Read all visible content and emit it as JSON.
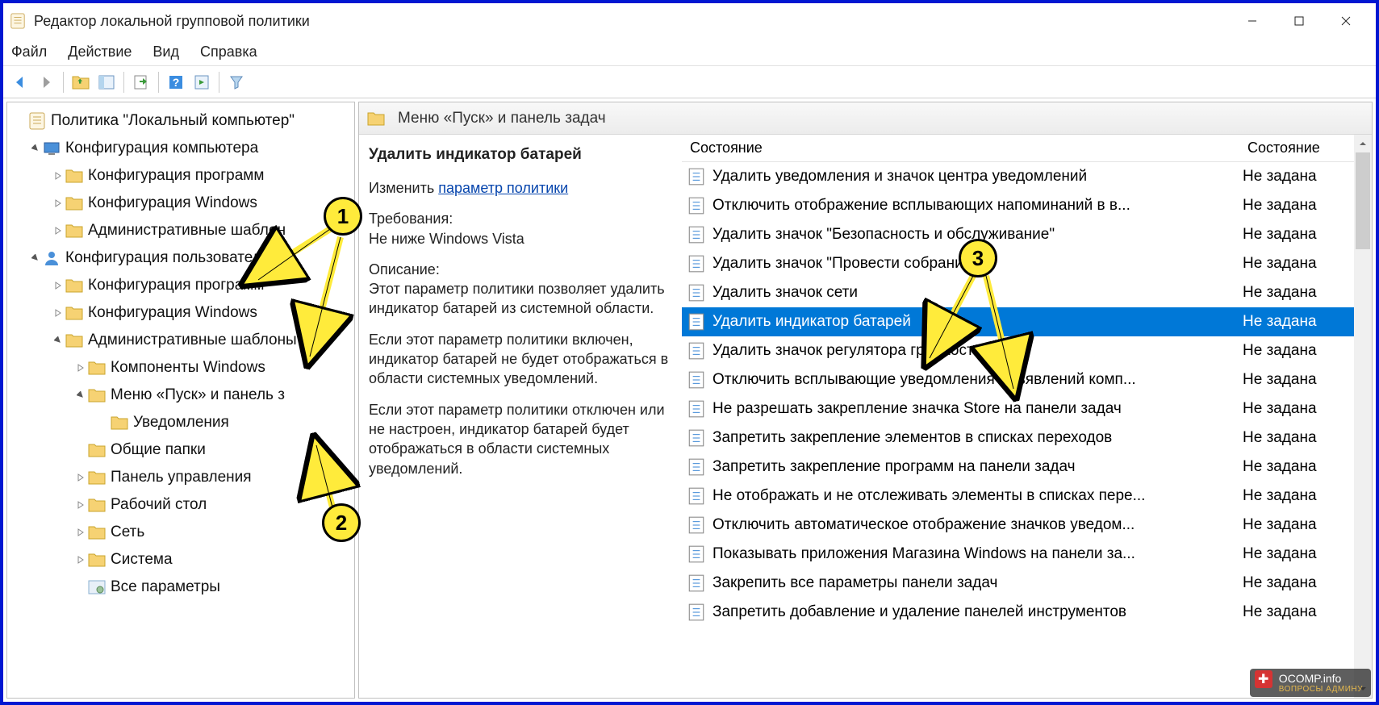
{
  "window": {
    "title": "Редактор локальной групповой политики"
  },
  "menu": {
    "file": "Файл",
    "action": "Действие",
    "view": "Вид",
    "help": "Справка"
  },
  "tree": {
    "root": "Политика \"Локальный компьютер\"",
    "comp_conf": "Конфигурация компьютера",
    "comp_prog": "Конфигурация программ",
    "comp_win": "Конфигурация Windows",
    "comp_admin": "Административные шаблон",
    "user_conf": "Конфигурация пользователя",
    "user_prog": "Конфигурация программ",
    "user_win": "Конфигурация Windows",
    "user_admin": "Административные шаблоны",
    "comp_windows": "Компоненты Windows",
    "start_menu": "Меню «Пуск» и панель з",
    "notifications": "Уведомления",
    "shared": "Общие папки",
    "cpanel": "Панель управления",
    "desktop": "Рабочий стол",
    "network": "Сеть",
    "system": "Система",
    "all": "Все параметры"
  },
  "content": {
    "header": "Меню «Пуск» и панель задач",
    "desc_title": "Удалить индикатор батарей",
    "edit_label": "Изменить ",
    "edit_link": "параметр политики",
    "req_label": "Требования:",
    "req_text": "Не ниже Windows Vista",
    "desc_label": "Описание:",
    "desc_p1": "Этот параметр политики позволяет удалить индикатор батарей из системной области.",
    "desc_p2": "Если этот параметр политики включен, индикатор батарей не будет отображаться в области системных уведомлений.",
    "desc_p3": "Если этот параметр политики отключен или не настроен, индикатор батарей будет отображаться в области системных уведомлений."
  },
  "list": {
    "col1": "Состояние",
    "col2": "Состояние",
    "state": "Не задана",
    "items": [
      "Удалить уведомления и значок центра уведомлений",
      "Отключить отображение всплывающих напоминаний в в...",
      "Удалить значок \"Безопасность и обслуживание\"",
      "Удалить значок \"Провести собрание\"",
      "Удалить значок сети",
      "Удалить индикатор батарей",
      "Удалить значок регулятора громкости",
      "Отключить всплывающие уведомления объявлений комп...",
      "Не разрешать закрепление значка Store на панели задач",
      "Запретить закрепление элементов в списках переходов",
      "Запретить закрепление программ на панели задач",
      "Не отображать и не отслеживать элементы в списках пере...",
      "Отключить автоматическое отображение значков уведом...",
      "Показывать приложения Магазина Windows на панели за...",
      "Закрепить все параметры панели задач",
      "Запретить добавление и удаление панелей инструментов"
    ],
    "selected_index": 5
  },
  "badges": {
    "b1": "1",
    "b2": "2",
    "b3": "3"
  },
  "watermark": {
    "site": "OCOMP.info",
    "sub": "ВОПРОСЫ АДМИНУ"
  }
}
